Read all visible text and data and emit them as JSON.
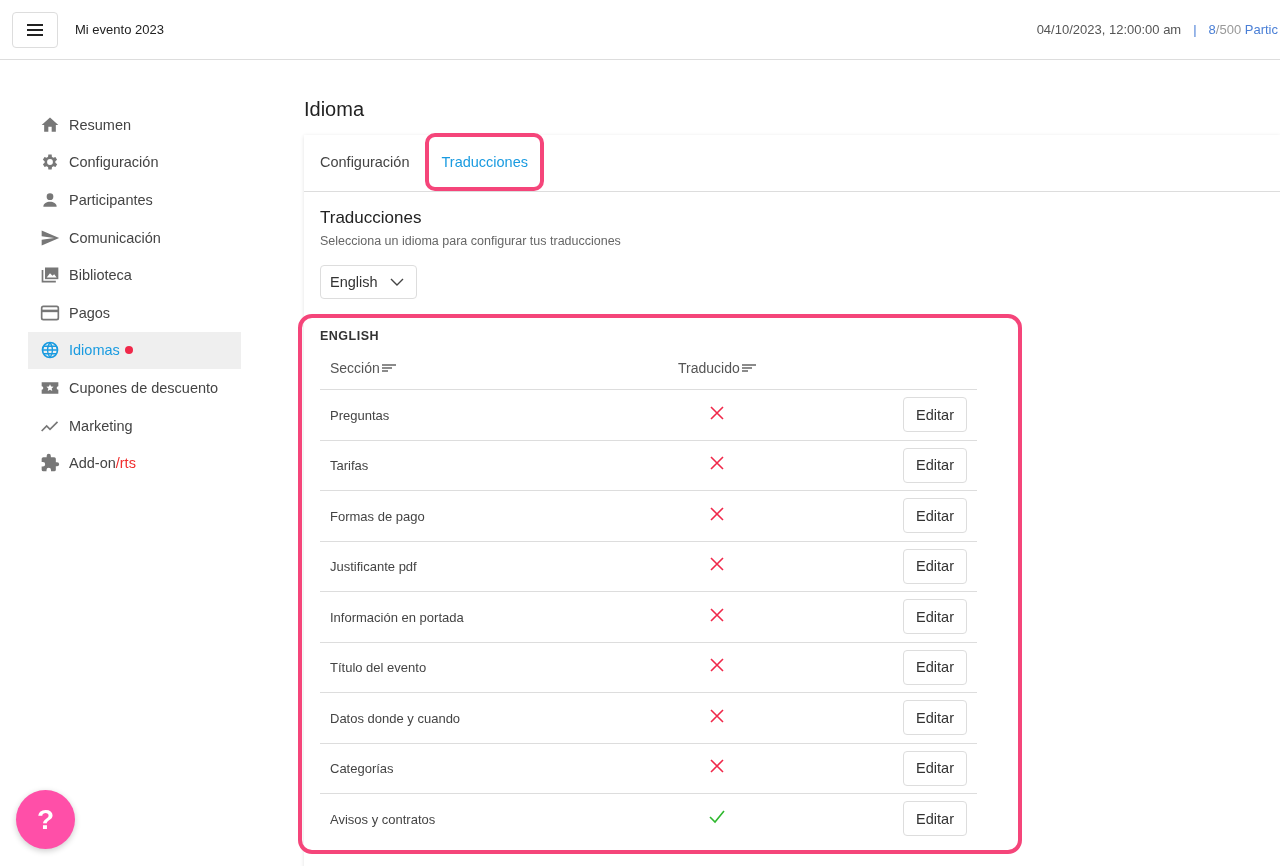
{
  "header": {
    "event_name": "Mi evento 2023",
    "datetime": "04/10/2023, 12:00:00 am",
    "separator": "|",
    "participants_count": "8",
    "participants_total": "/500",
    "participants_label": "Partic"
  },
  "sidebar": {
    "items": [
      {
        "label": "Resumen",
        "selected": false,
        "notification": false
      },
      {
        "label": "Configuración",
        "selected": false,
        "notification": false
      },
      {
        "label": "Participantes",
        "selected": false,
        "notification": false
      },
      {
        "label": "Comunicación",
        "selected": false,
        "notification": false
      },
      {
        "label": "Biblioteca",
        "selected": false,
        "notification": false
      },
      {
        "label": "Pagos",
        "selected": false,
        "notification": false
      },
      {
        "label": "Idiomas",
        "selected": true,
        "notification": true
      },
      {
        "label": "Cupones de descuento",
        "selected": false,
        "notification": false
      },
      {
        "label": "Marketing",
        "selected": false,
        "notification": false
      },
      {
        "label": "Add-on",
        "suffix": "/rts",
        "selected": false,
        "notification": false
      }
    ]
  },
  "page_title": "Idioma",
  "tabs": [
    {
      "label": "Configuración",
      "selected": false,
      "highlighted": false
    },
    {
      "label": "Traducciones",
      "selected": true,
      "highlighted": true
    }
  ],
  "translations": {
    "title": "Traducciones",
    "subtitle": "Selecciona un idioma para configurar tus traducciones",
    "language_select": {
      "value": "English"
    },
    "section": {
      "title": "ENGLISH",
      "highlighted": true,
      "columns": [
        "Sección",
        "Traducido"
      ],
      "rows": [
        {
          "section": "Preguntas",
          "translated": false,
          "action": "Editar"
        },
        {
          "section": "Tarifas",
          "translated": false,
          "action": "Editar"
        },
        {
          "section": "Formas de pago",
          "translated": false,
          "action": "Editar"
        },
        {
          "section": "Justificante pdf",
          "translated": false,
          "action": "Editar"
        },
        {
          "section": "Información en portada",
          "translated": false,
          "action": "Editar"
        },
        {
          "section": "Título del evento",
          "translated": false,
          "action": "Editar"
        },
        {
          "section": "Datos donde y cuando",
          "translated": false,
          "action": "Editar"
        },
        {
          "section": "Categorías",
          "translated": false,
          "action": "Editar"
        },
        {
          "section": "Avisos y contratos",
          "translated": true,
          "action": "Editar"
        }
      ]
    }
  },
  "help_button": {
    "label": "?"
  }
}
